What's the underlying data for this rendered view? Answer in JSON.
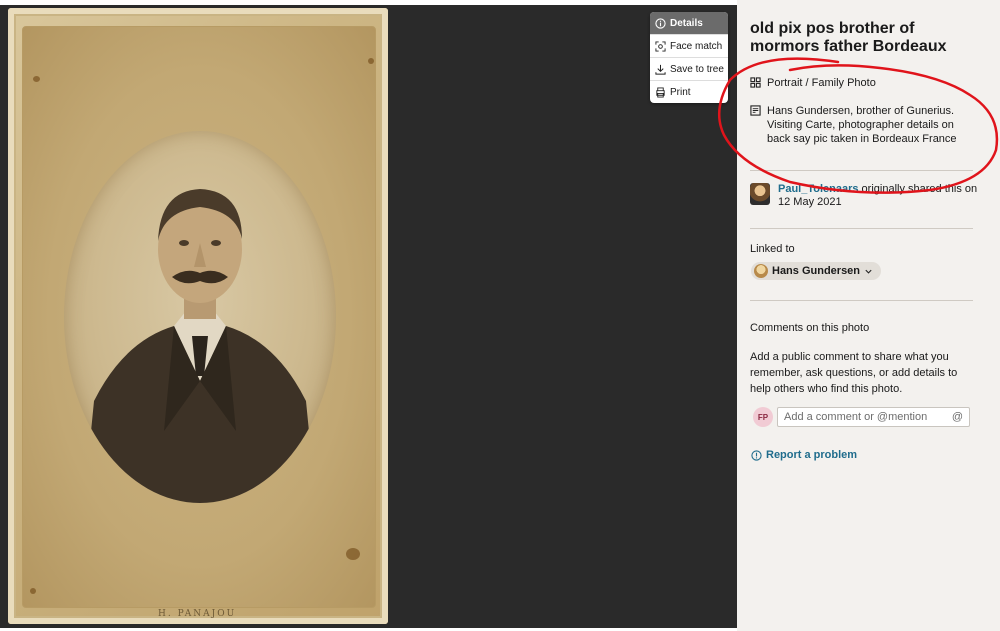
{
  "photo": {
    "photographer_caption": "H. PANAJOU"
  },
  "toolbar": {
    "details": "Details",
    "face_match": "Face match",
    "save_to_tree": "Save to tree",
    "print": "Print"
  },
  "details": {
    "title": "old pix pos brother of mormors father Bordeaux",
    "category": "Portrait / Family Photo",
    "description": "Hans Gundersen, brother of Gunerius. Visiting Carte, photographer details on back say pic taken in Bordeaux France",
    "shared_by": "Paul_Tolenaars",
    "shared_text": " originally shared this on 12 May 2021",
    "linked_to_label": "Linked to",
    "linked_person": "Hans Gundersen",
    "comments_heading": "Comments on this photo",
    "comments_help": "Add a public comment to share what you remember, ask questions, or add details to help others who find this photo.",
    "user_initials": "FP",
    "comment_placeholder": "Add a comment or @mention",
    "mention_symbol": "@",
    "report_problem": "Report a problem"
  },
  "colors": {
    "sidebar_bg": "#f3f1ee",
    "link": "#1f6c8c",
    "annotation": "#e0141b",
    "viewer_bg": "#2a2a2a"
  },
  "icons": [
    "info-icon",
    "face-match-icon",
    "download-icon",
    "print-icon",
    "category-icon",
    "description-icon",
    "chevron-down-icon",
    "alert-circle-icon"
  ]
}
